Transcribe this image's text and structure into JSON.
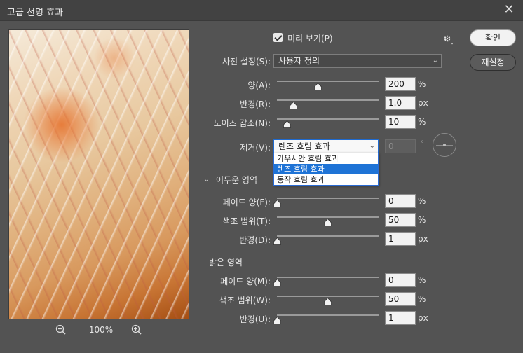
{
  "window": {
    "title": "고급 선명 효과"
  },
  "preview": {
    "zoom_level": "100%"
  },
  "preview_toggle": {
    "label": "미리 보기(P)",
    "checked": true
  },
  "buttons": {
    "ok": "확인",
    "reset": "재설정"
  },
  "preset": {
    "label": "사전 설정(S):",
    "value": "사용자 정의"
  },
  "amount": {
    "label": "양(A):",
    "value": "200",
    "unit": "%",
    "level": 0.4
  },
  "radius": {
    "label": "반경(R):",
    "value": "1.0",
    "unit": "px",
    "level": 0.16
  },
  "noise": {
    "label": "노이즈 감소(N):",
    "value": "10",
    "unit": "%",
    "level": 0.1
  },
  "remove": {
    "label": "제거(V):",
    "value": "렌즈 흐림 효과",
    "angle": "0",
    "degree_symbol": "°",
    "options": [
      "가우시안 흐림 효과",
      "렌즈 흐림 효과",
      "동작 흐림 효과"
    ],
    "selected_index": 1
  },
  "shadows": {
    "title": "어두운 영역",
    "fade": {
      "label": "페이드 양(F):",
      "value": "0",
      "unit": "%",
      "level": 0.0
    },
    "tonal": {
      "label": "색조 범위(T):",
      "value": "50",
      "unit": "%",
      "level": 0.5
    },
    "radius": {
      "label": "반경(D):",
      "value": "1",
      "unit": "px",
      "level": 0.0
    }
  },
  "highlights": {
    "title": "밝은 영역",
    "fade": {
      "label": "페이드 양(M):",
      "value": "0",
      "unit": "%",
      "level": 0.0
    },
    "tonal": {
      "label": "색조 범위(W):",
      "value": "50",
      "unit": "%",
      "level": 0.5
    },
    "radius": {
      "label": "반경(U):",
      "value": "1",
      "unit": "px",
      "level": 0.0
    }
  },
  "colors": {
    "background": "#535353",
    "titlebar": "#424242",
    "accent": "#1e73d6"
  },
  "icons": {
    "close": "close-icon",
    "gear": "gear-icon",
    "zoom_out": "zoom-out-icon",
    "zoom_in": "zoom-in-icon",
    "chevron": "chevron-down-icon"
  }
}
